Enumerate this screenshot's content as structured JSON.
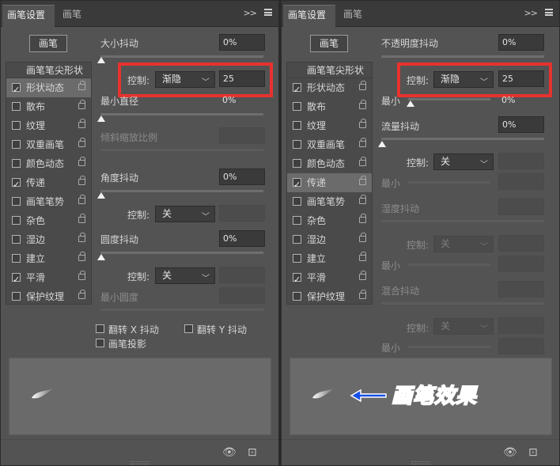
{
  "left_panel": {
    "tabs": [
      "画笔设置",
      "画笔"
    ],
    "preset_button": "画笔",
    "list_header": "画笔笔尖形状",
    "items": [
      {
        "label": "形状动态",
        "checked": true
      },
      {
        "label": "散布",
        "checked": false
      },
      {
        "label": "纹理",
        "checked": false
      },
      {
        "label": "双重画笔",
        "checked": false
      },
      {
        "label": "颜色动态",
        "checked": false
      },
      {
        "label": "传递",
        "checked": true
      },
      {
        "label": "画笔笔势",
        "checked": false
      },
      {
        "label": "杂色",
        "checked": false
      },
      {
        "label": "湿边",
        "checked": false
      },
      {
        "label": "建立",
        "checked": false
      },
      {
        "label": "平滑",
        "checked": true
      },
      {
        "label": "保护纹理",
        "checked": false
      }
    ],
    "size_jitter_label": "大小抖动",
    "size_jitter_value": "0%",
    "control_label": "控制:",
    "control_value": "渐隐",
    "control_steps": "25",
    "min_diameter_label": "最小直径",
    "min_diameter_value": "0%",
    "tilt_scale_label": "倾斜缩放比例",
    "angle_jitter_label": "角度抖动",
    "angle_jitter_value": "0%",
    "angle_control_label": "控制:",
    "angle_control_value": "关",
    "roundness_jitter_label": "圆度抖动",
    "roundness_jitter_value": "0%",
    "round_control_label": "控制:",
    "round_control_value": "关",
    "min_roundness_label": "最小圆度",
    "flip_x": "翻转 X 抖动",
    "flip_y": "翻转 Y 抖动",
    "brush_projection": "画笔投影"
  },
  "right_panel": {
    "tabs": [
      "画笔设置",
      "画笔"
    ],
    "preset_button": "画笔",
    "list_header": "画笔笔尖形状",
    "items": [
      {
        "label": "形状动态",
        "checked": true
      },
      {
        "label": "散布",
        "checked": false
      },
      {
        "label": "纹理",
        "checked": false
      },
      {
        "label": "双重画笔",
        "checked": false
      },
      {
        "label": "颜色动态",
        "checked": false
      },
      {
        "label": "传递",
        "checked": true
      },
      {
        "label": "画笔笔势",
        "checked": false
      },
      {
        "label": "杂色",
        "checked": false
      },
      {
        "label": "湿边",
        "checked": false
      },
      {
        "label": "建立",
        "checked": false
      },
      {
        "label": "平滑",
        "checked": true
      },
      {
        "label": "保护纹理",
        "checked": false
      }
    ],
    "opacity_jitter_label": "不透明度抖动",
    "opacity_jitter_value": "0%",
    "control_label": "控制:",
    "control_value": "渐隐",
    "control_steps": "25",
    "min_label_1": "最小",
    "min_value_1": "0%",
    "flow_jitter_label": "流量抖动",
    "flow_jitter_value": "0%",
    "flow_control_label": "控制:",
    "flow_control_value": "关",
    "min_label_2": "最小",
    "wetness_jitter_label": "湿度抖动",
    "wet_control_label": "控制:",
    "wet_control_value": "关",
    "min_label_3": "最小",
    "mix_jitter_label": "混合抖动",
    "mix_control_label": "控制:",
    "mix_control_value": "关",
    "min_label_4": "最小",
    "effect_label": "画笔效果"
  },
  "colors": {
    "panel_bg": "#535353",
    "highlight_red": "#e8322e",
    "effect_blue": "#1750e8"
  }
}
